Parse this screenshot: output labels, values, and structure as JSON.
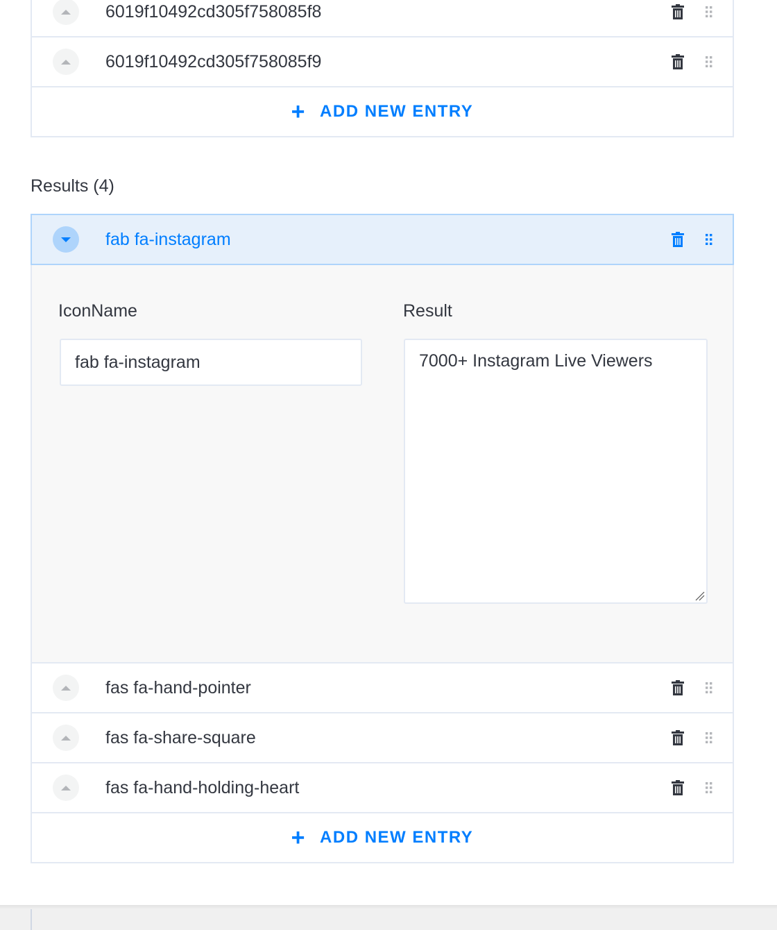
{
  "top_list": {
    "rows": [
      {
        "label": "6019f10492cd305f758085f8"
      },
      {
        "label": "6019f10492cd305f758085f9"
      }
    ],
    "add_label": "ADD NEW ENTRY"
  },
  "results": {
    "title": "Results (4)",
    "active_row": {
      "label": "fab fa-instagram"
    },
    "expanded": {
      "icon_name_label": "IconName",
      "icon_name_value": "fab fa-instagram",
      "result_label": "Result",
      "result_value": "7000+ Instagram Live Viewers"
    },
    "rows": [
      {
        "label": "fas fa-hand-pointer"
      },
      {
        "label": "fas fa-share-square"
      },
      {
        "label": "fas fa-hand-holding-heart"
      }
    ],
    "add_label": "ADD NEW ENTRY"
  },
  "colors": {
    "accent": "#007eff",
    "active_bg": "#e6f0fb",
    "active_border": "#aed4fb",
    "border": "#e3e9f3",
    "text": "#333740"
  },
  "icons": {
    "delete": "trash-icon",
    "drag": "drag-handle-icon",
    "collapse": "caret-up-icon",
    "expand": "caret-down-icon",
    "add": "plus-icon"
  }
}
